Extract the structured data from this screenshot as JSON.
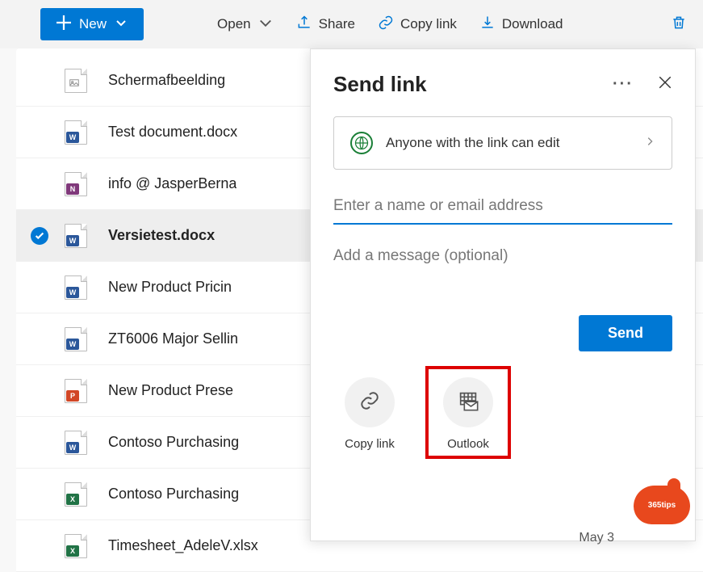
{
  "toolbar": {
    "new_label": "New",
    "open_label": "Open",
    "share_label": "Share",
    "copylink_label": "Copy link",
    "download_label": "Download"
  },
  "files": [
    {
      "name": "Schermafbeelding",
      "type": "img",
      "selected": false
    },
    {
      "name": "Test document.docx",
      "type": "word",
      "selected": false
    },
    {
      "name": "info @ JasperBerna",
      "type": "one",
      "selected": false
    },
    {
      "name": "Versietest.docx",
      "type": "word",
      "selected": true
    },
    {
      "name": "New Product Pricin",
      "type": "word",
      "selected": false
    },
    {
      "name": "ZT6006 Major Sellin",
      "type": "word",
      "selected": false
    },
    {
      "name": "New Product Prese",
      "type": "ppt",
      "selected": false
    },
    {
      "name": "Contoso Purchasing",
      "type": "word",
      "selected": false
    },
    {
      "name": "Contoso Purchasing",
      "type": "xls",
      "selected": false
    },
    {
      "name": "Timesheet_AdeleV.xlsx",
      "type": "xls",
      "selected": false
    }
  ],
  "panel": {
    "title": "Send link",
    "permission_text": "Anyone with the link can edit",
    "name_placeholder": "Enter a name or email address",
    "message_placeholder": "Add a message (optional)",
    "send_label": "Send",
    "copylink_label": "Copy link",
    "outlook_label": "Outlook"
  },
  "badge_text": "365tips",
  "date_peek": "May 3"
}
